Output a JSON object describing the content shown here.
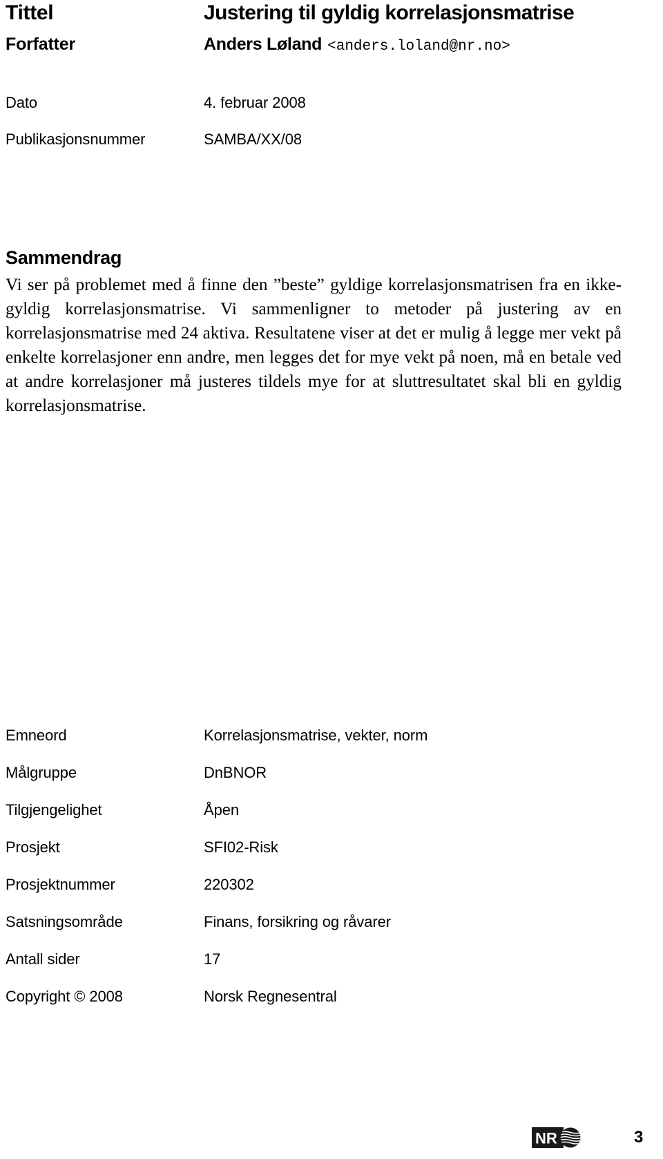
{
  "document": {
    "header_rows": [
      {
        "label": "Tittel",
        "value": "Justering til gyldig korrelasjonsmatrise"
      },
      {
        "label": "Forfatter",
        "value": "Anders Løland",
        "email": "<anders.loland@nr.no>"
      },
      {
        "label": "Dato",
        "value": "4. februar 2008"
      },
      {
        "label": "Publikasjonsnummer",
        "value": "SAMBA/XX/08"
      }
    ],
    "abstract": {
      "heading": "Sammendrag",
      "body": "Vi ser på problemet med å finne den ”beste” gyldige korrelasjonsmatrisen fra en ikke-gyldig korrelasjonsmatrise. Vi sammenligner to metoder på justering av en korrelasjonsmatrise med 24 aktiva. Resultatene viser at det er mulig å legge mer vekt på enkelte korrelasjoner enn andre, men legges det for mye vekt på noen, må en betale ved at andre korrelasjoner må justeres tildels mye for at sluttresultatet skal bli en gyldig korrelasjonsmatrise."
    },
    "meta_rows": [
      {
        "label": "Emneord",
        "value": "Korrelasjonsmatrise, vekter, norm"
      },
      {
        "label": "Målgruppe",
        "value": "DnBNOR"
      },
      {
        "label": "Tilgjengelighet",
        "value": "Åpen"
      },
      {
        "label": "Prosjekt",
        "value": "SFI02-Risk"
      },
      {
        "label": "Prosjektnummer",
        "value": "220302"
      },
      {
        "label": "Satsningsområde",
        "value": "Finans, forsikring og råvarer"
      },
      {
        "label": "Antall sider",
        "value": "17"
      },
      {
        "label": "Copyright © 2008",
        "value": "Norsk Regnesentral"
      }
    ],
    "footer": {
      "logo_text": "NR",
      "page_number": "3"
    }
  }
}
